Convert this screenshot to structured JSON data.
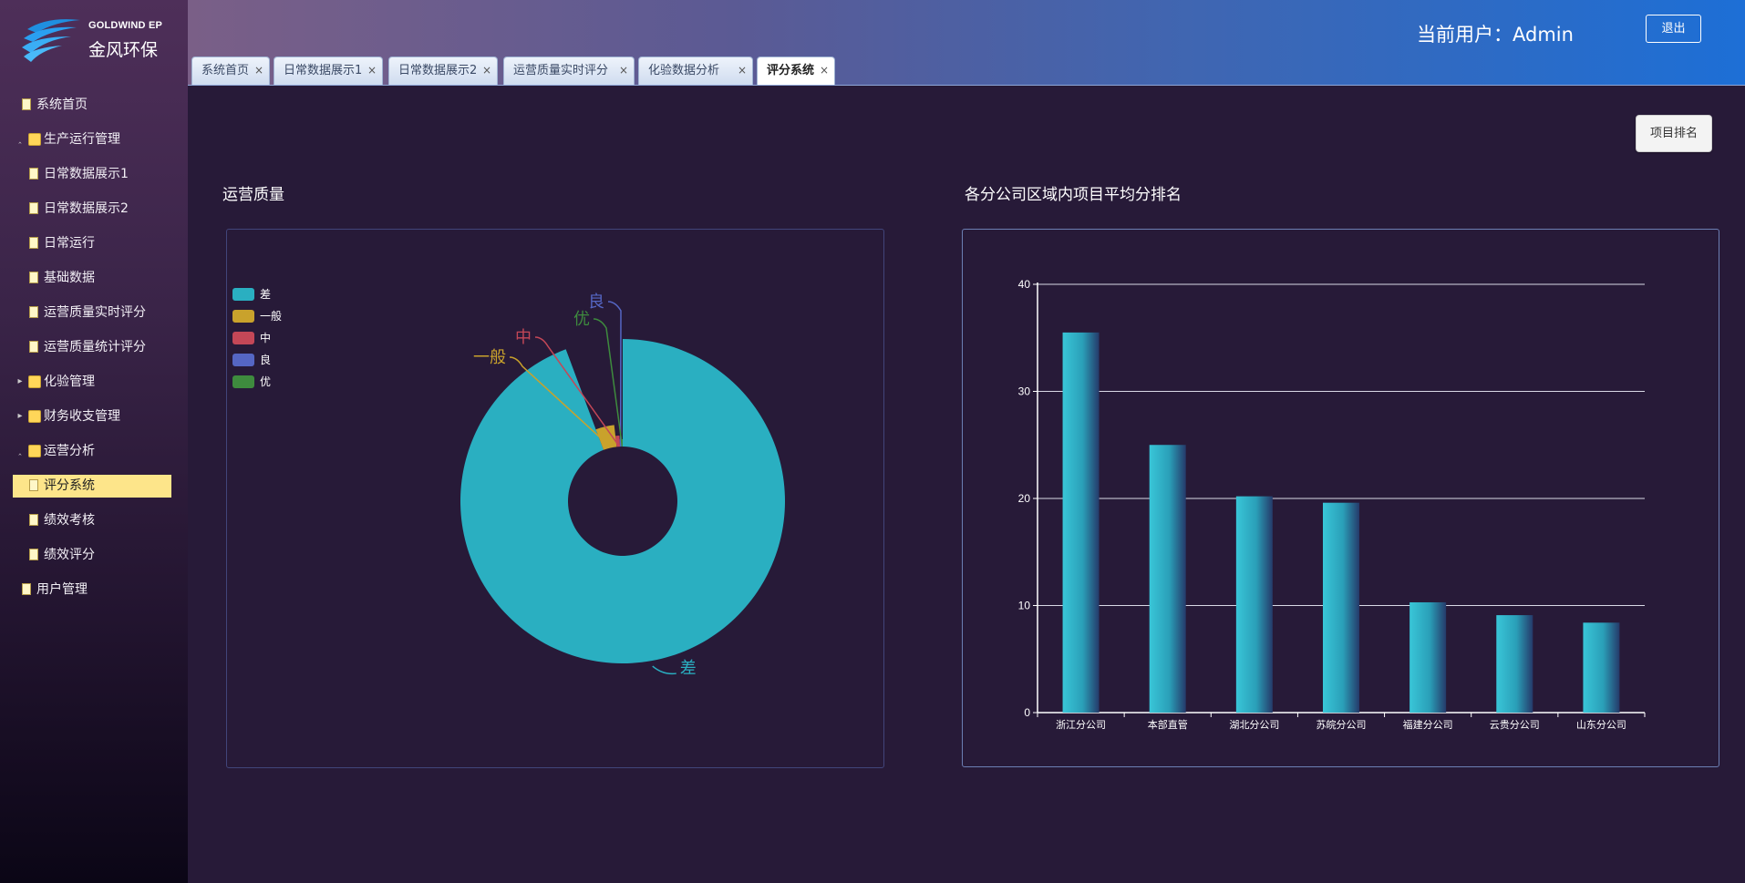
{
  "brand": {
    "en": "GOLDWIND EP",
    "cn": "金风环保"
  },
  "header": {
    "current_user": "当前用户：Admin",
    "logout": "退出"
  },
  "tabs": [
    {
      "label": "系统首页",
      "close": "×"
    },
    {
      "label": "日常数据展示1",
      "close": "×"
    },
    {
      "label": "日常数据展示2",
      "close": "×"
    },
    {
      "label": "运营质量实时评分",
      "close": "×"
    },
    {
      "label": "化验数据分析",
      "close": "×"
    },
    {
      "label": "评分系统",
      "close": "×",
      "active": true
    }
  ],
  "sidebar": {
    "items": [
      {
        "label": "系统首页",
        "type": "file",
        "level": 0
      },
      {
        "label": "生产运行管理",
        "type": "folder",
        "level": 0,
        "expanded": true
      },
      {
        "label": "日常数据展示1",
        "type": "file",
        "level": 1
      },
      {
        "label": "日常数据展示2",
        "type": "file",
        "level": 1
      },
      {
        "label": "日常运行",
        "type": "file",
        "level": 1
      },
      {
        "label": "基础数据",
        "type": "file",
        "level": 1
      },
      {
        "label": "运营质量实时评分",
        "type": "file",
        "level": 1
      },
      {
        "label": "运营质量统计评分",
        "type": "file",
        "level": 1
      },
      {
        "label": "化验管理",
        "type": "folder",
        "level": 0,
        "expanded": false
      },
      {
        "label": "财务收支管理",
        "type": "folder",
        "level": 0,
        "expanded": false
      },
      {
        "label": "运营分析",
        "type": "folder",
        "level": 0,
        "expanded": true
      },
      {
        "label": "评分系统",
        "type": "file",
        "level": 1,
        "selected": true
      },
      {
        "label": "绩效考核",
        "type": "file",
        "level": 1
      },
      {
        "label": "绩效评分",
        "type": "file",
        "level": 1
      },
      {
        "label": "用户管理",
        "type": "file",
        "level": 0
      }
    ]
  },
  "main": {
    "rank_button": "项目排名",
    "left_title": "运营质量",
    "right_title": "各分公司区域内项目平均分排名"
  },
  "colors": {
    "差": "#2aafc1",
    "一般": "#c9a22c",
    "中": "#c44757",
    "良": "#5566c4",
    "优": "#3e8b3e"
  },
  "chart_data": [
    {
      "type": "pie",
      "variant": "rose-donut",
      "title": "",
      "legend_position": "top-left",
      "legend": [
        "差",
        "一般",
        "中",
        "良",
        "优"
      ],
      "slices": [
        {
          "name": "差",
          "value": 48,
          "color": "#2aafc1"
        },
        {
          "name": "一般",
          "value": 2,
          "color": "#c9a22c"
        },
        {
          "name": "中",
          "value": 0.5,
          "color": "#c44757"
        },
        {
          "name": "良",
          "value": 0.2,
          "color": "#5566c4"
        },
        {
          "name": "优",
          "value": 0.2,
          "color": "#3e8b3e"
        }
      ]
    },
    {
      "type": "bar",
      "title": "",
      "categories": [
        "浙江分公司",
        "本部直管",
        "湖北分公司",
        "苏皖分公司",
        "福建分公司",
        "云贵分公司",
        "山东分公司"
      ],
      "values": [
        35.5,
        25,
        20.2,
        19.6,
        10.3,
        9.1,
        8.4
      ],
      "ylim": [
        0,
        40
      ],
      "yticks": [
        "0",
        "10",
        "20",
        "30",
        "40"
      ],
      "grid": true,
      "legend": false
    }
  ]
}
